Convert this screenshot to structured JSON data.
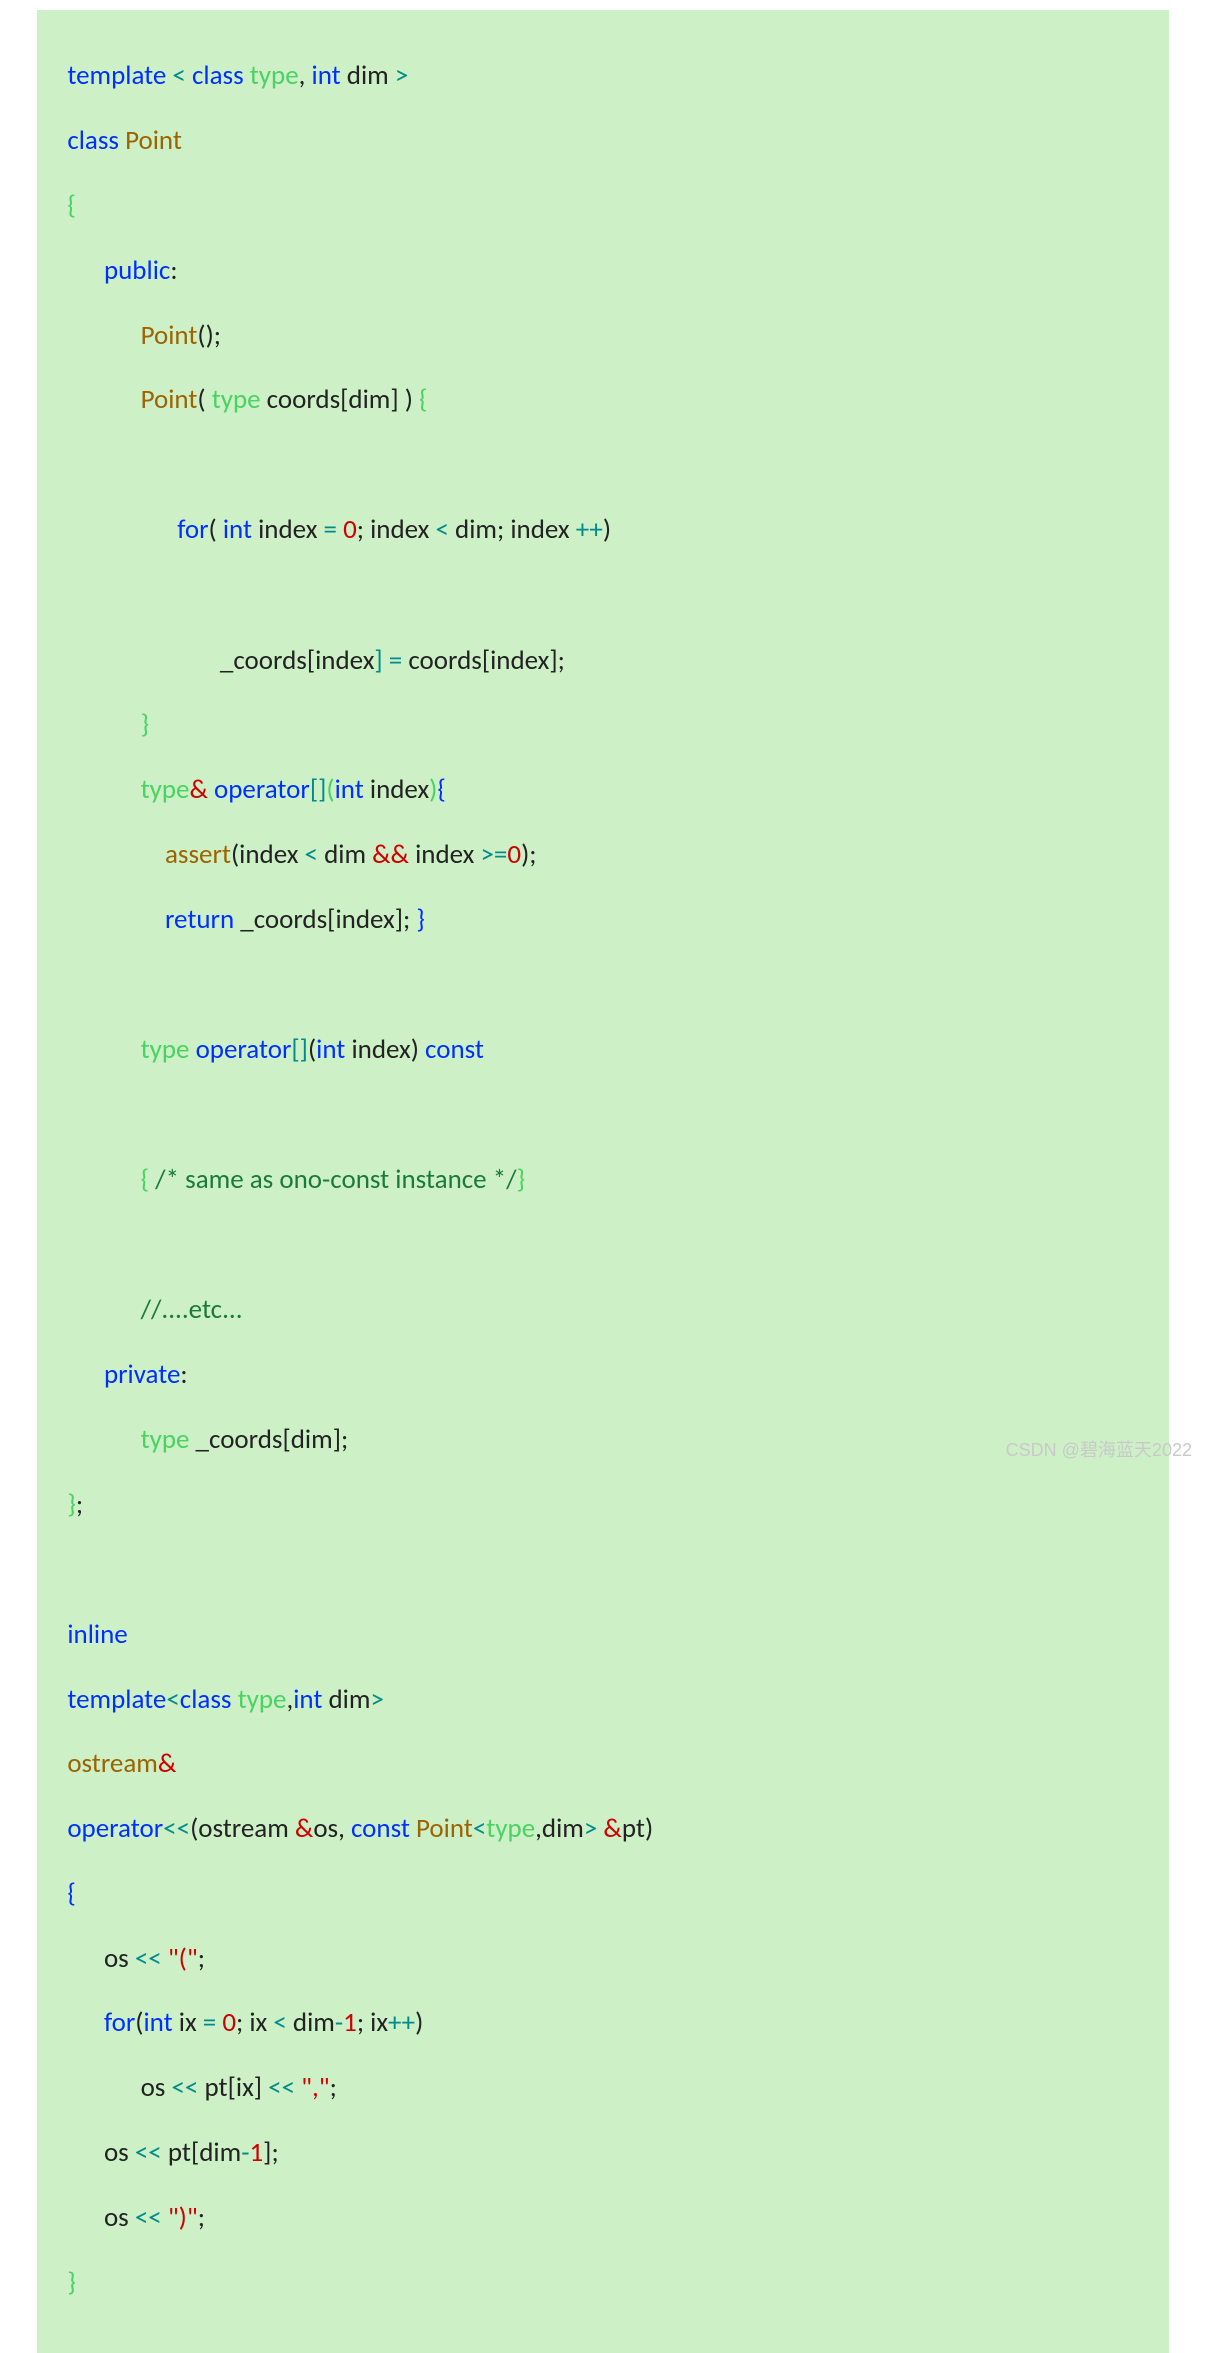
{
  "watermark": "CSDN @碧海蓝天2022",
  "code": {
    "l1": {
      "a": "template",
      "b": " < ",
      "c": "class",
      "d": " ",
      "e": "type",
      "f": ", ",
      "g": "int",
      "h": " dim ",
      "i": ">"
    },
    "l2": {
      "a": "class",
      "b": " ",
      "c": "Point"
    },
    "l3": {
      "a": "{"
    },
    "l4": {
      "a": "public",
      "b": ":"
    },
    "l5": {
      "a": "Point",
      "b": "();"
    },
    "l6": {
      "a": "Point",
      "b": "( ",
      "c": "type",
      "d": " coords[dim] ) ",
      "e": "{"
    },
    "l7": {
      "a": "for",
      "b": "( ",
      "c": "int",
      "d": " index ",
      "e": "=",
      "f": " ",
      "g": "0",
      "h": "; index ",
      "i": "<",
      "j": " dim; index ",
      "k": "++",
      "l": ")"
    },
    "l8": {
      "a": "_coords[index",
      "b": "]",
      "c": " ",
      "d": "=",
      "e": " coords[index];"
    },
    "l9": {
      "a": "}"
    },
    "l10": {
      "a": "type",
      "b": "&",
      "c": " ",
      "d": "operator",
      "e": "[]",
      "f": "(",
      "g": "int",
      "h": " index",
      "i": ")",
      "j": "{"
    },
    "l11": {
      "a": "assert",
      "b": "(",
      "c": "index ",
      "d": "<",
      "e": " dim ",
      "f": "&&",
      "g": " index ",
      "h": ">=",
      "i": "0",
      "j": ");"
    },
    "l12": {
      "a": "return",
      "b": " _coords[index]; ",
      "c": "}"
    },
    "l13": {
      "a": "type",
      "b": " ",
      "c": "operator",
      "d": "[]",
      "e": "(",
      "f": "int",
      "g": " index) ",
      "h": "const"
    },
    "l14": {
      "a": "{",
      "b": " /* same as ono-const instance */",
      "c": "}"
    },
    "l15": {
      "a": "//....etc..."
    },
    "l16": {
      "a": "private",
      "b": ":"
    },
    "l17": {
      "a": "type",
      "b": " _coords[dim];"
    },
    "l18": {
      "a": "}",
      "b": ";"
    },
    "l19": {
      "a": "inline"
    },
    "l20": {
      "a": "template",
      "b": "<",
      "c": "class",
      "d": " ",
      "e": "type",
      "f": ",",
      "g": "int",
      "h": " dim",
      "i": ">"
    },
    "l21": {
      "a": "ostream",
      "b": "&"
    },
    "l22": {
      "a": "operator",
      "b": "<<",
      "c": "(ostream ",
      "d": "&",
      "e": "os, ",
      "f": "const",
      "g": " ",
      "h": "Point",
      "i": "<",
      "j": "type",
      "k": ",dim",
      "l": ">",
      "m": " ",
      "n": "&",
      "o": "pt)"
    },
    "l23": {
      "a": "{"
    },
    "l24": {
      "a": "os ",
      "b": "<<",
      "c": " ",
      "d": "\"(\"",
      "e": ";"
    },
    "l25": {
      "a": "for",
      "b": "(",
      "c": "int",
      "d": " ix ",
      "e": "=",
      "f": " ",
      "g": "0",
      "h": "; ix ",
      "i": "<",
      "j": " dim",
      "k": "-",
      "l": "1",
      "m": "; ix",
      "n": "++",
      "o": ")"
    },
    "l26": {
      "a": "os ",
      "b": "<<",
      "c": " pt[ix] ",
      "d": "<<",
      "e": " ",
      "f": "\",\"",
      "g": ";"
    },
    "l27": {
      "a": "os ",
      "b": "<<",
      "c": " pt[dim",
      "d": "-",
      "e": "1",
      "f": "];"
    },
    "l28": {
      "a": "os ",
      "b": "<<",
      "c": " ",
      "d": "\")\"",
      "e": ";"
    },
    "l29": {
      "a": "}"
    }
  }
}
